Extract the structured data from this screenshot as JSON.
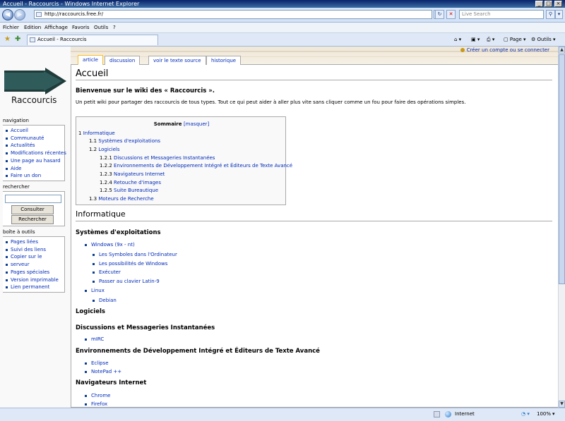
{
  "window": {
    "title": "Accueil - Raccourcis - Windows Internet Explorer"
  },
  "addressbar": {
    "url": "http://raccourcis.free.fr/",
    "search_placeholder": "Live Search"
  },
  "menubar": {
    "items": [
      "Fichier",
      "Edition",
      "Affichage",
      "Favoris",
      "Outils",
      "?"
    ]
  },
  "tabbar": {
    "tab_label": "Accueil - Raccourcis",
    "page_label": "Page",
    "tools_label": "Outils"
  },
  "personal": {
    "create_account": "Créer un compte ou se connecter"
  },
  "content_tabs": [
    "article",
    "discussion",
    "voir le texte source",
    "historique"
  ],
  "logo": {
    "text": "Raccourcis"
  },
  "sidebar": {
    "navigation_title": "navigation",
    "navigation_items": [
      "Accueil",
      "Communauté",
      "Actualités",
      "Modifications récentes",
      "Une page au hasard",
      "Aide",
      "Faire un don"
    ],
    "search_title": "rechercher",
    "search_button_go": "Consulter",
    "search_button_search": "Rechercher",
    "toolbox_title": "boîte à outils",
    "toolbox_items": [
      "Pages liées",
      "Suivi des liens",
      "Copier sur le",
      "serveur",
      "Pages spéciales",
      "Version imprimable",
      "Lien permanent"
    ]
  },
  "article": {
    "title": "Accueil",
    "intro": "Bienvenue sur le wiki des « Raccourcis ».",
    "paragraph": "Un petit wiki pour partager des raccourcis de tous types. Tout ce qui peut aider à aller plus vite sans cliquer comme un fou pour faire des opérations simples.",
    "toc": {
      "title": "Sommaire",
      "toggle": "[masquer]",
      "items": [
        {
          "num": "1",
          "text": "Informatique"
        },
        {
          "num": "1.1",
          "text": "Systèmes d'exploitations"
        },
        {
          "num": "1.2",
          "text": "Logiciels"
        },
        {
          "num": "1.2.1",
          "text": "Discussions et Messageries Instantanées"
        },
        {
          "num": "1.2.2",
          "text": "Environnements de Développement Intégré et Éditeurs de Texte Avancé"
        },
        {
          "num": "1.2.3",
          "text": "Navigateurs Internet"
        },
        {
          "num": "1.2.4",
          "text": "Retouche d'images"
        },
        {
          "num": "1.2.5",
          "text": "Suite Bureautique"
        },
        {
          "num": "1.3",
          "text": "Moteurs de Recherche"
        }
      ]
    },
    "h_informatique": "Informatique",
    "h_systemes": "Systèmes d'exploitations",
    "systemes_list": [
      "Windows (9x - nt)",
      "Les Symboles dans l'Ordinateur",
      "Les possibilités de Windows",
      "Exécuter",
      "Passer au clavier Latin-9",
      "Linux",
      "Debian"
    ],
    "h_logiciels": "Logiciels",
    "h_discussions": "Discussions et Messageries Instantanées",
    "discussions_list": [
      "mIRC"
    ],
    "h_ide": "Environnements de Développement Intégré et Éditeurs de Texte Avancé",
    "ide_list": [
      "Eclipse",
      "NotePad ++"
    ],
    "h_navigateurs": "Navigateurs Internet",
    "navigateurs_list": [
      "Chrome",
      "Firefox"
    ]
  },
  "statusbar": {
    "zone": "Internet",
    "zoom": "100%"
  }
}
